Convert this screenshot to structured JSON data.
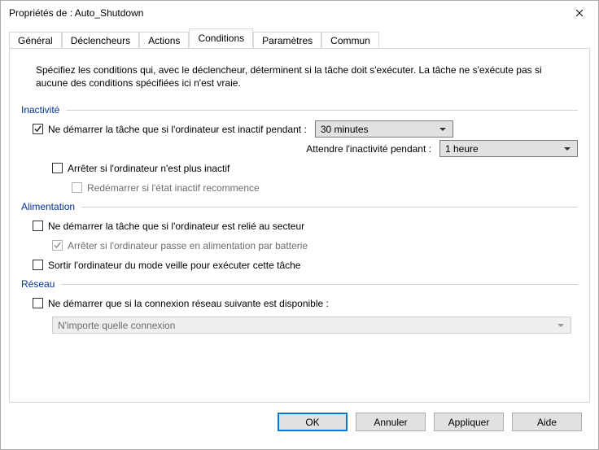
{
  "window": {
    "title": "Propriétés de : Auto_Shutdown"
  },
  "tabs": {
    "general": "Général",
    "triggers": "Déclencheurs",
    "actions": "Actions",
    "conditions": "Conditions",
    "settings": "Paramètres",
    "common": "Commun",
    "active": "conditions"
  },
  "description": "Spécifiez les conditions qui, avec le déclencheur, déterminent si la tâche doit s'exécuter. La tâche ne s'exécute pas si aucune des conditions spécifiées ici n'est vraie.",
  "sections": {
    "idle": {
      "title": "Inactivité",
      "start_only_if_idle": {
        "label": "Ne démarrer la tâche que si l'ordinateur est inactif pendant :",
        "checked": true,
        "idle_duration": {
          "value": "30 minutes"
        }
      },
      "wait_for_idle": {
        "label": "Attendre l'inactivité pendant :",
        "value": "1 heure"
      },
      "stop_if_not_idle": {
        "label": "Arrêter si l'ordinateur n'est plus inactif",
        "checked": false
      },
      "restart_if_idle": {
        "label": "Redémarrer si l'état inactif recommence",
        "checked": false,
        "enabled": false
      }
    },
    "power": {
      "title": "Alimentation",
      "start_only_on_ac": {
        "label": "Ne démarrer la tâche que si l'ordinateur est relié au secteur",
        "checked": false
      },
      "stop_on_battery": {
        "label": "Arrêter si l'ordinateur passe en alimentation par batterie",
        "checked": true,
        "enabled": false
      },
      "wake_to_run": {
        "label": "Sortir l'ordinateur du mode veille pour exécuter cette tâche",
        "checked": false
      }
    },
    "network": {
      "title": "Réseau",
      "start_only_if_network": {
        "label": "Ne démarrer que si la connexion réseau suivante est disponible :",
        "checked": false
      },
      "connection": {
        "value": "N'importe quelle connexion",
        "enabled": false
      }
    }
  },
  "buttons": {
    "ok": "OK",
    "cancel": "Annuler",
    "apply": "Appliquer",
    "help": "Aide"
  }
}
